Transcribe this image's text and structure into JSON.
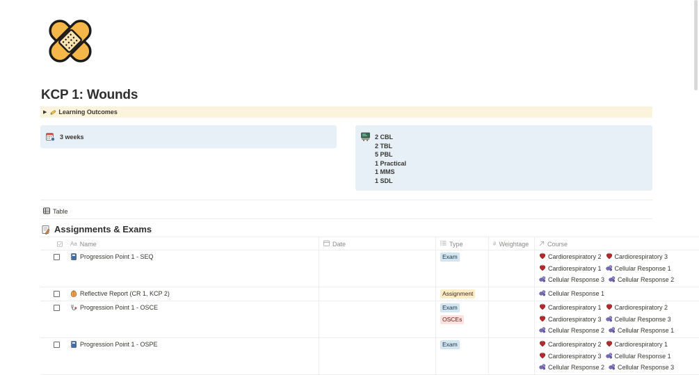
{
  "page": {
    "title": "KCP 1: Wounds",
    "icon": "bandage-icon"
  },
  "toggle": {
    "label": "Learning Outcomes",
    "icon": "pencil-icon"
  },
  "callouts": {
    "duration": {
      "icon": "calendar-icon",
      "text": "3 weeks"
    },
    "sessions": {
      "icon": "classroom-icon",
      "lines": [
        "2 CBL",
        "2 TBL",
        "5 PBL",
        "1 Practical",
        "1 MMS",
        "1 SDL"
      ]
    }
  },
  "view": {
    "tab_label": "Table",
    "icon": "table-icon"
  },
  "database": {
    "title": "Assignments & Exams",
    "icon": "memo-icon",
    "columns": {
      "name": "Name",
      "date": "Date",
      "type": "Type",
      "weightage": "Weightage",
      "course": "Course"
    },
    "rows": [
      {
        "name": "Progression Point 1 - SEQ",
        "icon": "notebook-icon",
        "types": [
          "Exam"
        ],
        "courses": [
          "Cardiorespiratory 2",
          "Cardiorespiratory 3",
          "Cardiorespiratory 1",
          "Cellular Response 1",
          "Cellular Response 3",
          "Cellular Response 2"
        ]
      },
      {
        "name": "Reflective Report (CR 1, KCP 2)",
        "icon": "brain-icon",
        "types": [
          "Assignment"
        ],
        "courses": [
          "Cellular Response 1"
        ]
      },
      {
        "name": "Progression Point 1 - OSCE",
        "icon": "stethoscope-icon",
        "types": [
          "Exam",
          "OSCEs"
        ],
        "courses": [
          "Cardiorespiratory 1",
          "Cardiorespiratory 2",
          "Cardiorespiratory 3",
          "Cellular Response 3",
          "Cellular Response 2",
          "Cellular Response 1"
        ]
      },
      {
        "name": "Progression Point 1 - OSPE",
        "icon": "notebook-icon",
        "types": [
          "Exam"
        ],
        "courses": [
          "Cardiorespiratory 2",
          "Cardiorespiratory 1",
          "Cardiorespiratory 3",
          "Cellular Response 1",
          "Cellular Response 2",
          "Cellular Response 3"
        ]
      }
    ]
  },
  "colors": {
    "toggle_bg": "#fbf3db",
    "callout_bg": "#e7f0f7",
    "tag_exam": "#d3e5ef",
    "tag_assignment": "#fdecc8",
    "tag_osce": "#ffe2dd"
  }
}
